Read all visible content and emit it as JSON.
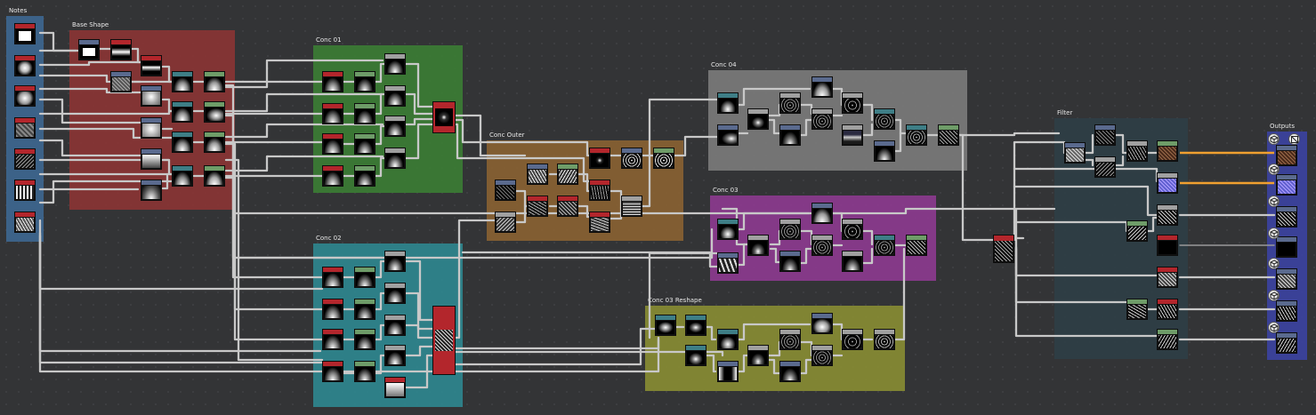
{
  "frames": {
    "notes": {
      "title": "Notes",
      "color": "#3d6791"
    },
    "base_shape": {
      "title": "Base Shape",
      "color": "#8b3434"
    },
    "conc_01": {
      "title": "Conc 01",
      "color": "#3b7c34"
    },
    "conc_02": {
      "title": "Conc 02",
      "color": "#2e8790"
    },
    "conc_outer": {
      "title": "Conc Outer",
      "color": "#8a6232"
    },
    "conc_04": {
      "title": "Conc 04",
      "color": "#7a7a7a"
    },
    "conc_03": {
      "title": "Conc 03",
      "color": "#8b3a8e"
    },
    "conc_03_reshape": {
      "title": "Conc 03 Reshape",
      "color": "#878b33"
    },
    "filter": {
      "title": "Filter",
      "color": "#2e3e46"
    },
    "outputs": {
      "title": "Outputs",
      "color": "#3b42a0"
    }
  },
  "header_colors": {
    "red": "#b3262c",
    "green": "#6e9c68",
    "blue": "#5a6a8e",
    "teal": "#3e7e86",
    "gray": "#a0a0a0",
    "brown": "#7a4a2a"
  },
  "wire_colors": {
    "default": "#c8c8c8",
    "highlight": "#f0a030"
  },
  "output_icons": [
    "cube-icon",
    "cube-icon",
    "cube-icon",
    "cube-icon",
    "cube-icon",
    "cube-icon",
    "cube-icon"
  ]
}
